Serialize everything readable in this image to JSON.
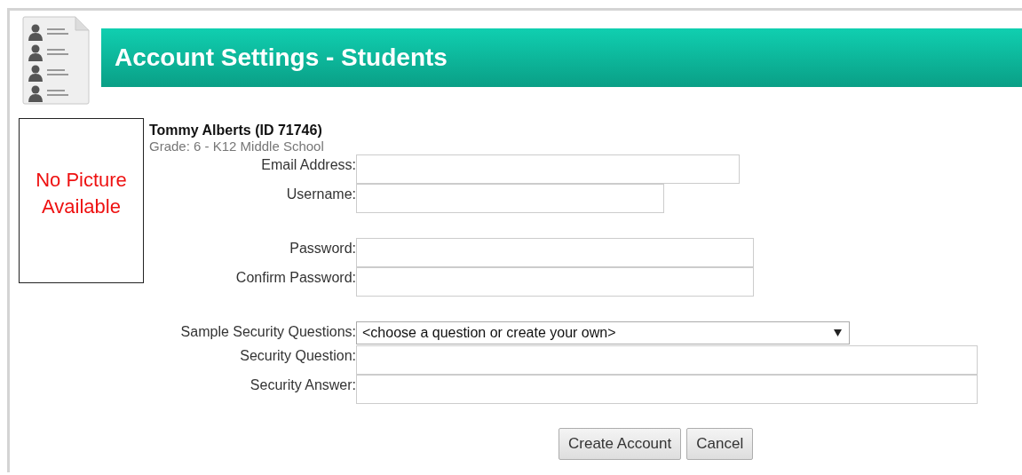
{
  "header": {
    "title": "Account Settings - Students"
  },
  "photo": {
    "text": "No Picture Available"
  },
  "student": {
    "name": "Tommy Alberts (ID 71746)",
    "grade": "Grade: 6 - K12 Middle School"
  },
  "groups": [
    {
      "fields": [
        {
          "kind": "text",
          "label": "Email Address:"
        },
        {
          "kind": "text",
          "label": "Username:"
        }
      ]
    },
    {
      "fields": [
        {
          "kind": "password",
          "label": "Password:"
        },
        {
          "kind": "password",
          "label": "Confirm Password:"
        }
      ]
    },
    {
      "fields": [
        {
          "kind": "select",
          "label": "Sample Security Questions:",
          "value": "<choose a question or create your own>"
        },
        {
          "kind": "text",
          "label": "Security Question:"
        },
        {
          "kind": "text",
          "label": "Security Answer:"
        }
      ]
    }
  ],
  "buttons": [
    "Create Account",
    "Cancel"
  ]
}
